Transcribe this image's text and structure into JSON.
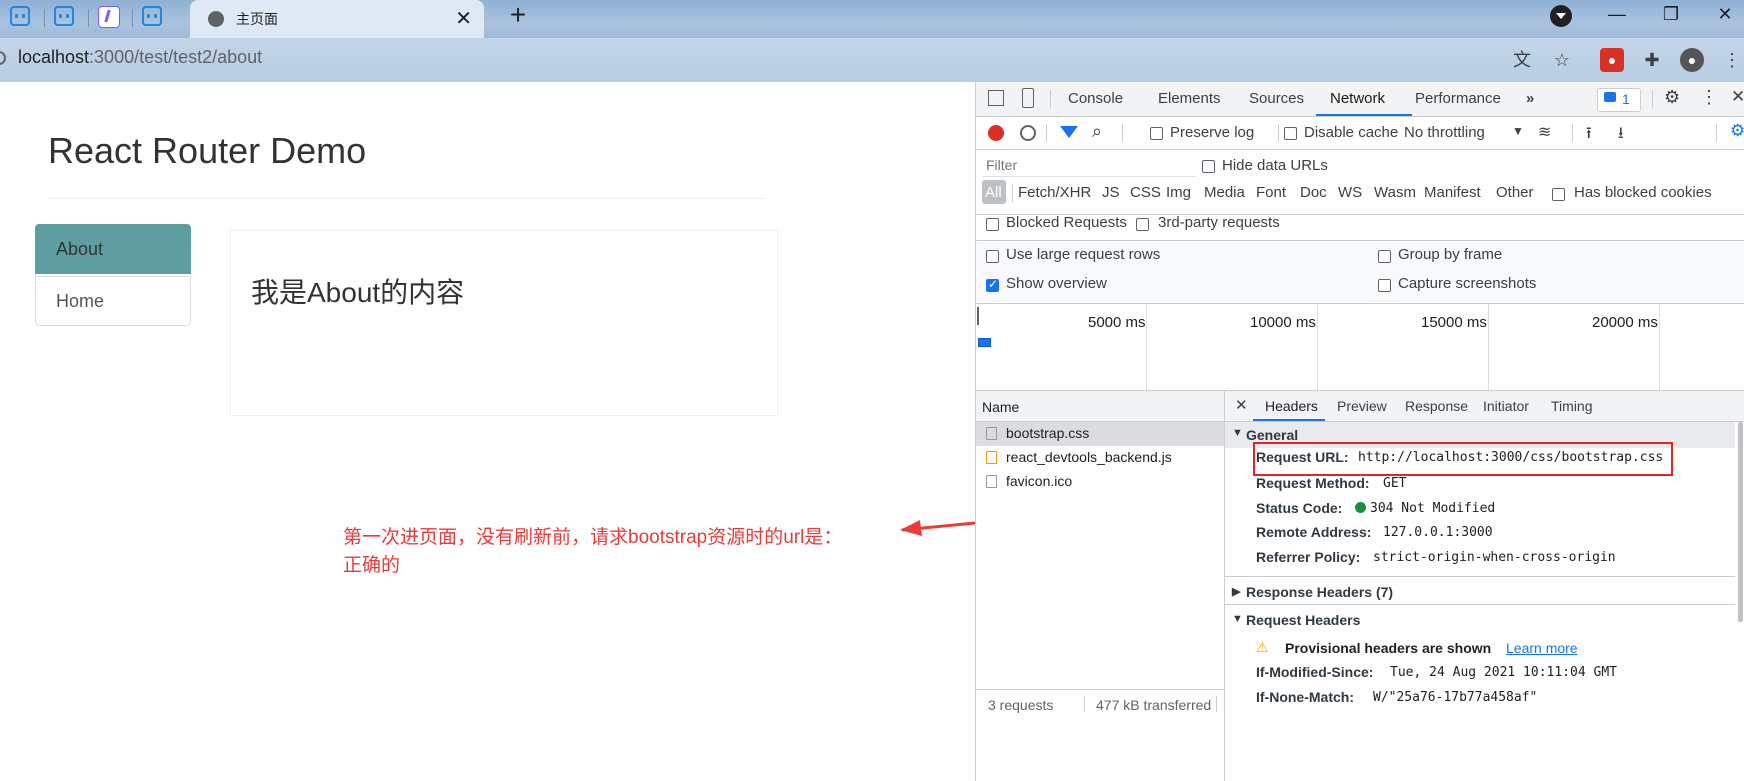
{
  "browser": {
    "active_tab_title": "主页面",
    "url_host": "localhost",
    "url_rest": ":3000/test/test2/about",
    "colors": {
      "tab_active": "#dfe9f5",
      "accent": "#1a73e8"
    }
  },
  "page": {
    "title": "React Router Demo",
    "nav": [
      {
        "label": "About",
        "active": true
      },
      {
        "label": "Home",
        "active": false
      }
    ],
    "content": "我是About的内容",
    "annotation_line1": "第一次进页面，没有刷新前，请求bootstrap资源时的url是：",
    "annotation_line2": "正确的",
    "nav_active_color": "#5f9ea0",
    "annotation_color": "#e83b3b"
  },
  "devtools": {
    "tabs": [
      "Console",
      "Elements",
      "Sources",
      "Network",
      "Performance"
    ],
    "active_tab": "Network",
    "issues_count": "1",
    "toolbar": {
      "preserve_log": "Preserve log",
      "disable_cache": "Disable cache",
      "throttling": "No throttling"
    },
    "filter": {
      "placeholder": "Filter",
      "hide_data_urls": "Hide data URLs",
      "types": [
        "All",
        "Fetch/XHR",
        "JS",
        "CSS",
        "Img",
        "Media",
        "Font",
        "Doc",
        "WS",
        "Wasm",
        "Manifest",
        "Other"
      ],
      "has_blocked_cookies": "Has blocked cookies",
      "blocked_requests": "Blocked Requests",
      "third_party": "3rd-party requests"
    },
    "settings": {
      "large_rows": "Use large request rows",
      "group_by_frame": "Group by frame",
      "show_overview": "Show overview",
      "capture_screenshots": "Capture screenshots"
    },
    "timeline_ticks": [
      "5000 ms",
      "10000 ms",
      "15000 ms",
      "20000 ms"
    ],
    "requests": {
      "column": "Name",
      "items": [
        "bootstrap.css",
        "react_devtools_backend.js",
        "favicon.ico"
      ],
      "status_requests": "3 requests",
      "status_transferred": "477 kB transferred"
    },
    "detail": {
      "tabs": [
        "Headers",
        "Preview",
        "Response",
        "Initiator",
        "Timing"
      ],
      "general_title": "General",
      "request_url_k": "Request URL:",
      "request_url_v": "http://localhost:3000/css/bootstrap.css",
      "request_method_k": "Request Method:",
      "request_method_v": "GET",
      "status_code_k": "Status Code:",
      "status_code_v": "304 Not Modified",
      "remote_address_k": "Remote Address:",
      "remote_address_v": "127.0.0.1:3000",
      "referrer_policy_k": "Referrer Policy:",
      "referrer_policy_v": "strict-origin-when-cross-origin",
      "response_headers_title": "Response Headers (7)",
      "request_headers_title": "Request Headers",
      "provisional": "Provisional headers are shown",
      "learn_more": "Learn more",
      "if_modified_since_k": "If-Modified-Since:",
      "if_modified_since_v": "Tue, 24 Aug 2021 10:11:04 GMT",
      "if_none_match_k": "If-None-Match:",
      "if_none_match_v": "W/\"25a76-17b77a458af\""
    }
  }
}
